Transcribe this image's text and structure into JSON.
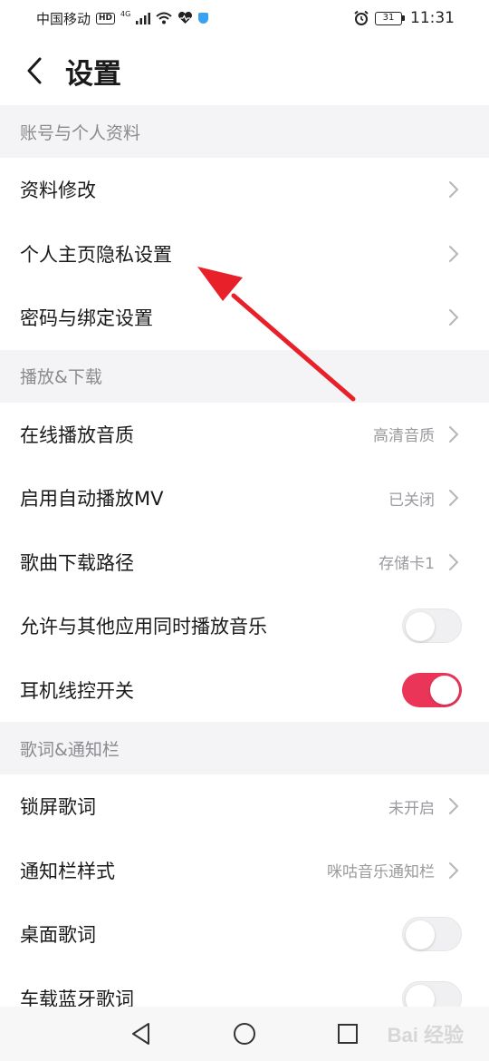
{
  "status_bar": {
    "carrier": "中国移动",
    "hd": "HD",
    "network": "4G",
    "battery": "31",
    "time": "11:31"
  },
  "header": {
    "title": "设置"
  },
  "sections": [
    {
      "title": "账号与个人资料",
      "rows": [
        {
          "label": "资料修改",
          "value": "",
          "control": "chevron"
        },
        {
          "label": "个人主页隐私设置",
          "value": "",
          "control": "chevron"
        },
        {
          "label": "密码与绑定设置",
          "value": "",
          "control": "chevron"
        }
      ]
    },
    {
      "title": "播放&下载",
      "rows": [
        {
          "label": "在线播放音质",
          "value": "高清音质",
          "control": "chevron"
        },
        {
          "label": "启用自动播放MV",
          "value": "已关闭",
          "control": "chevron"
        },
        {
          "label": "歌曲下载路径",
          "value": "存储卡1",
          "control": "chevron"
        },
        {
          "label": "允许与其他应用同时播放音乐",
          "value": "",
          "control": "toggle",
          "on": false
        },
        {
          "label": "耳机线控开关",
          "value": "",
          "control": "toggle",
          "on": true
        }
      ]
    },
    {
      "title": "歌词&通知栏",
      "rows": [
        {
          "label": "锁屏歌词",
          "value": "未开启",
          "control": "chevron"
        },
        {
          "label": "通知栏样式",
          "value": "咪咕音乐通知栏",
          "control": "chevron"
        },
        {
          "label": "桌面歌词",
          "value": "",
          "control": "toggle",
          "on": false
        },
        {
          "label": "车载蓝牙歌词",
          "value": "",
          "control": "toggle",
          "on": false
        }
      ]
    }
  ],
  "watermark": "Bai 经验",
  "colors": {
    "accent": "#ea3559",
    "annotation_arrow": "#e8202a",
    "section_bg": "#f4f4f6"
  }
}
